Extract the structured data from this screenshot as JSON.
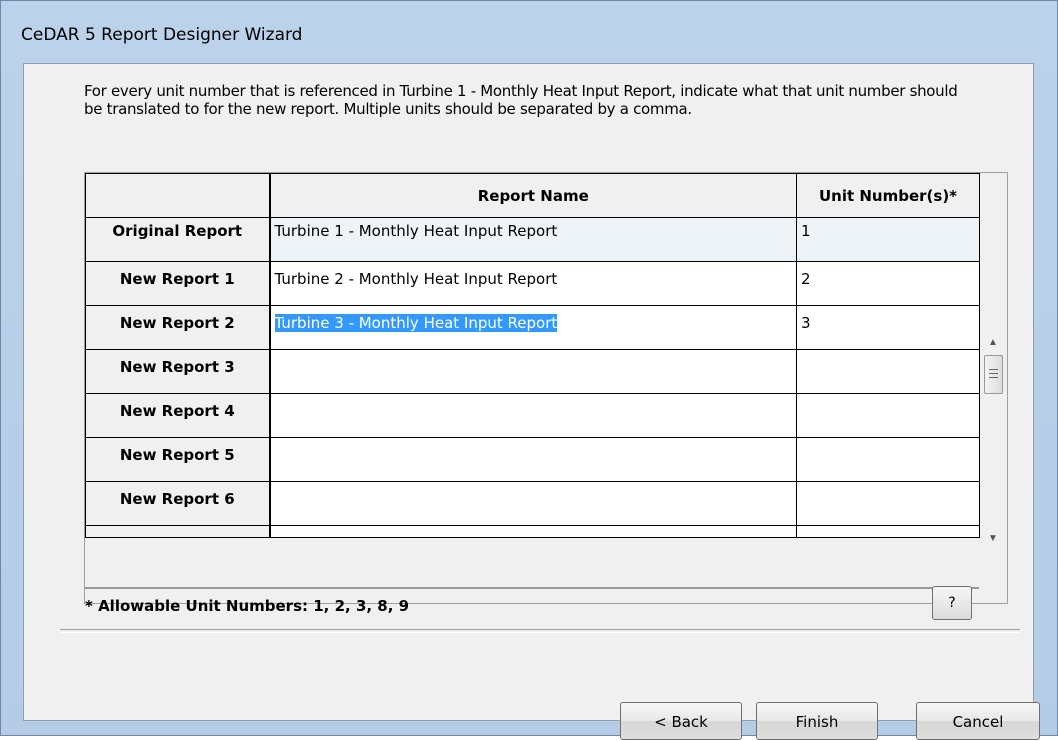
{
  "window": {
    "title": "CeDAR 5 Report Designer Wizard"
  },
  "instructions": "For every unit number that is referenced in Turbine 1 - Monthly Heat Input Report, indicate what that unit number should be translated to for the new report.  Multiple units should be separated by a comma.",
  "grid": {
    "headers": {
      "report_name": "Report Name",
      "unit_numbers": "Unit Number(s)*"
    },
    "rows": [
      {
        "label": "Original Report",
        "report_name": "Turbine 1 - Monthly Heat Input Report",
        "units": "1"
      },
      {
        "label": "New Report 1",
        "report_name": "Turbine 2 - Monthly Heat Input Report",
        "units": "2"
      },
      {
        "label": "New Report 2",
        "report_name": "Turbine 3 - Monthly Heat Input Report",
        "units": "3"
      },
      {
        "label": "New Report 3",
        "report_name": "",
        "units": ""
      },
      {
        "label": "New Report 4",
        "report_name": "",
        "units": ""
      },
      {
        "label": "New Report 5",
        "report_name": "",
        "units": ""
      },
      {
        "label": "New Report 6",
        "report_name": "",
        "units": ""
      }
    ]
  },
  "allowable_units": "* Allowable Unit Numbers: 1, 2, 3, 8, 9",
  "help_label": "?",
  "buttons": {
    "back": "< Back",
    "finish": "Finish",
    "cancel": "Cancel"
  }
}
